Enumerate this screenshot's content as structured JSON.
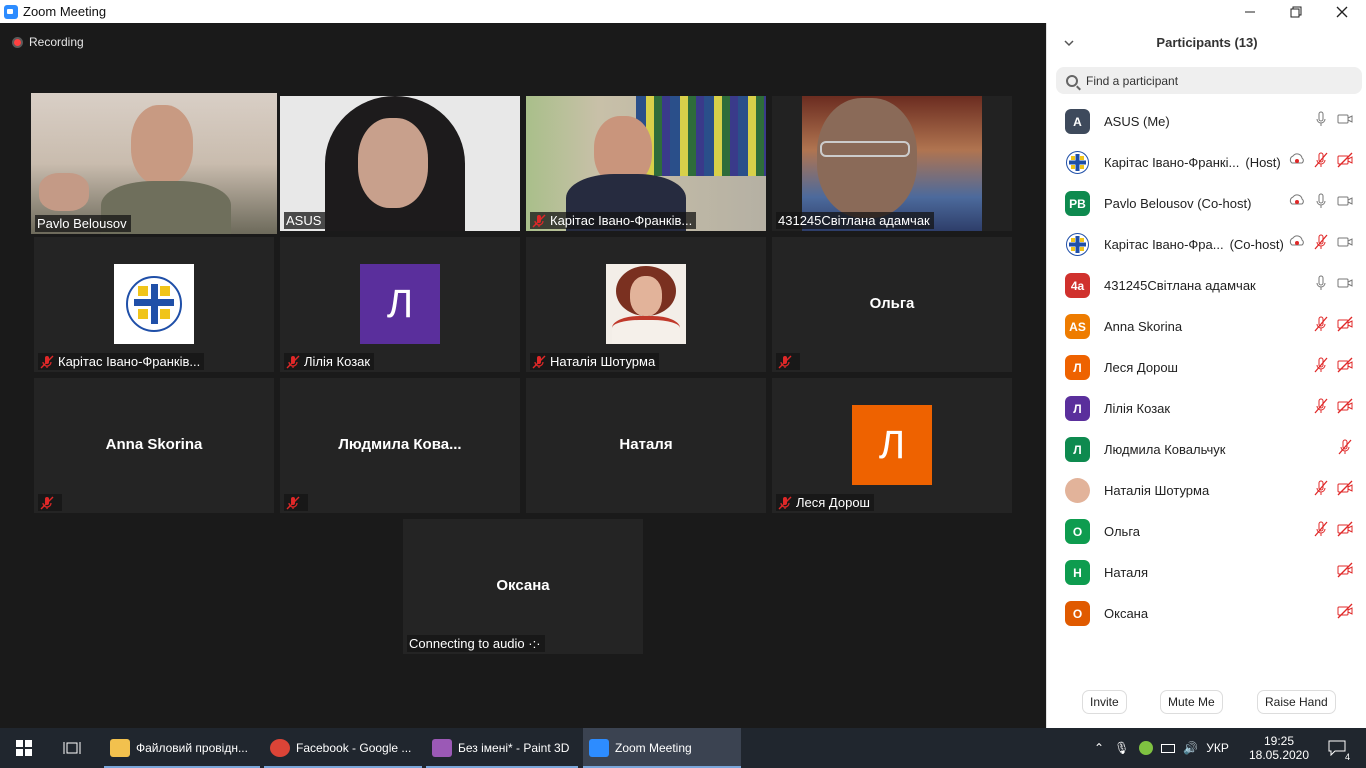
{
  "window": {
    "title": "Zoom Meeting"
  },
  "meeting": {
    "recording_label": "Recording",
    "tiles": [
      {
        "name": "Pavlo Belousov",
        "muted": false,
        "kind": "video"
      },
      {
        "name": "ASUS",
        "muted": false,
        "kind": "video"
      },
      {
        "name": "Карітас Івано-Франків...",
        "muted": true,
        "kind": "video"
      },
      {
        "name": "431245Світлана адамчак",
        "muted": false,
        "kind": "video"
      },
      {
        "name": "Карітас Івано-Франків...",
        "muted": true,
        "kind": "logo"
      },
      {
        "name": "Лілія Козак",
        "muted": true,
        "kind": "avatar",
        "initial": "Л",
        "color": "#5a2f9c"
      },
      {
        "name": "Наталія Шотурма",
        "muted": true,
        "kind": "photo"
      },
      {
        "name": "",
        "center": "Ольга",
        "muted": true,
        "kind": "name"
      },
      {
        "name": "",
        "center": "Anna Skorina",
        "muted": true,
        "kind": "name"
      },
      {
        "name": "",
        "center": "Людмила  Кова...",
        "muted": true,
        "kind": "name"
      },
      {
        "name": "",
        "center": "Наталя",
        "muted": false,
        "kind": "name"
      },
      {
        "name": "Леся Дорош",
        "muted": true,
        "kind": "avatar",
        "initial": "Л",
        "color": "#ee6200"
      },
      {
        "name": "Connecting to audio ·:·",
        "center": "Оксана",
        "muted": false,
        "kind": "name"
      }
    ]
  },
  "participants_panel": {
    "title": "Participants (13)",
    "search_placeholder": "Find a participant",
    "participants": [
      {
        "initials": "A",
        "color": "#3e4a5c",
        "name": "ASUS (Me)",
        "role": "",
        "mic": "on",
        "video": "on"
      },
      {
        "initials": "",
        "color": "#ffffff",
        "name": "Карітас Івано-Франкі...",
        "role": "(Host)",
        "mic": "off",
        "video": "off",
        "logo": true,
        "rec": true
      },
      {
        "initials": "PB",
        "color": "#0e8a4f",
        "name": "Pavlo Belousov (Co-host)",
        "role": "",
        "mic": "on",
        "video": "on",
        "rec": true
      },
      {
        "initials": "",
        "color": "#ffffff",
        "name": "Карітас Івано-Фра...",
        "role": "(Co-host)",
        "mic": "off",
        "video": "on",
        "logo": true,
        "rec": true
      },
      {
        "initials": "4a",
        "color": "#d0312d",
        "name": "431245Світлана адамчак",
        "role": "",
        "mic": "on",
        "video": "on"
      },
      {
        "initials": "AS",
        "color": "#ee7c00",
        "name": "Anna Skorina",
        "role": "",
        "mic": "off",
        "video": "off"
      },
      {
        "initials": "Л",
        "color": "#ee6200",
        "name": "Леся Дорош",
        "role": "",
        "mic": "off",
        "video": "off"
      },
      {
        "initials": "Л",
        "color": "#5a2f9c",
        "name": "Лілія Козак",
        "role": "",
        "mic": "off",
        "video": "off"
      },
      {
        "initials": "Л",
        "color": "#0e8a4f",
        "name": "Людмила Ковальчук",
        "role": "",
        "mic": "off",
        "video": "none"
      },
      {
        "initials": "",
        "color": "#b07a60",
        "name": "Наталія Шотурма",
        "role": "",
        "mic": "off",
        "video": "off",
        "photo": true
      },
      {
        "initials": "О",
        "color": "#0e9c4f",
        "name": "Ольга",
        "role": "",
        "mic": "off",
        "video": "off"
      },
      {
        "initials": "Н",
        "color": "#0e9c4f",
        "name": "Наталя",
        "role": "",
        "mic": "none",
        "video": "off"
      },
      {
        "initials": "О",
        "color": "#e05a00",
        "name": "Оксана",
        "role": "",
        "mic": "none",
        "video": "off"
      }
    ],
    "buttons": {
      "invite": "Invite",
      "mute_me": "Mute Me",
      "raise_hand": "Raise Hand"
    }
  },
  "taskbar": {
    "apps": [
      {
        "label": "Файловий провідн...",
        "icon": "folder-icon"
      },
      {
        "label": "Facebook - Google ...",
        "icon": "chrome-icon"
      },
      {
        "label": "Без імені* - Paint 3D",
        "icon": "paint3d-icon"
      },
      {
        "label": "Zoom Meeting",
        "icon": "zoom-icon"
      }
    ],
    "language": "УКР",
    "time": "19:25",
    "date": "18.05.2020",
    "notifications": "4"
  }
}
